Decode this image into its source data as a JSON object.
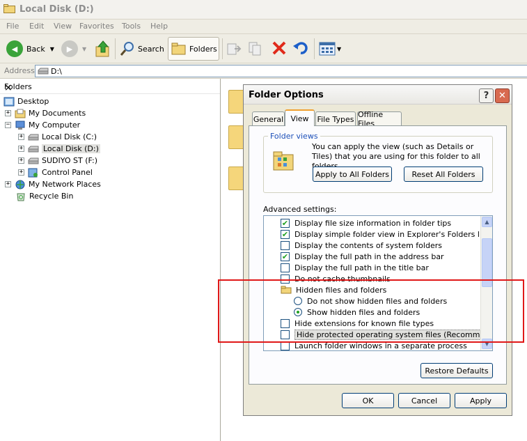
{
  "window": {
    "title": "Local Disk (D:)"
  },
  "menu": [
    "File",
    "Edit",
    "View",
    "Favorites",
    "Tools",
    "Help"
  ],
  "toolbar": {
    "back": "Back",
    "search": "Search",
    "folders": "Folders"
  },
  "address": {
    "label": "Address",
    "value": "D:\\"
  },
  "folders_pane": {
    "title": "Folders",
    "close": "×",
    "tree": [
      {
        "label": "Desktop",
        "expander": "",
        "selected": false
      },
      {
        "label": "My Documents",
        "expander": "+",
        "selected": false
      },
      {
        "label": "My Computer",
        "expander": "−",
        "selected": false
      },
      {
        "label": "Local Disk (C:)",
        "expander": "+",
        "selected": false
      },
      {
        "label": "Local Disk (D:)",
        "expander": "+",
        "selected": true
      },
      {
        "label": "SUDIYO ST (F:)",
        "expander": "+",
        "selected": false
      },
      {
        "label": "Control Panel",
        "expander": "+",
        "selected": false
      },
      {
        "label": "My Network Places",
        "expander": "+",
        "selected": false
      },
      {
        "label": "Recycle Bin",
        "expander": "",
        "selected": false
      }
    ]
  },
  "dialog": {
    "title": "Folder Options",
    "help": "?",
    "close": "✕",
    "tabs": [
      "General",
      "View",
      "File Types",
      "Offline Files"
    ],
    "active_tab": "View",
    "folder_views": {
      "legend": "Folder views",
      "text": "You can apply the view (such as Details or Tiles) that you are using for this folder to all folders.",
      "apply_all": "Apply to All Folders",
      "reset_all": "Reset All Folders"
    },
    "advanced_label": "Advanced settings:",
    "advanced": [
      {
        "kind": "checkbox",
        "label": "Display file size information in folder tips",
        "checked": true
      },
      {
        "kind": "checkbox",
        "label": "Display simple folder view in Explorer's Folders list",
        "checked": true
      },
      {
        "kind": "checkbox",
        "label": "Display the contents of system folders",
        "checked": false
      },
      {
        "kind": "checkbox",
        "label": "Display the full path in the address bar",
        "checked": true
      },
      {
        "kind": "checkbox",
        "label": "Display the full path in the title bar",
        "checked": false
      },
      {
        "kind": "checkbox",
        "label": "Do not cache thumbnails",
        "checked": false
      },
      {
        "kind": "folder",
        "label": "Hidden files and folders"
      },
      {
        "kind": "radio",
        "label": "Do not show hidden files and folders",
        "checked": false
      },
      {
        "kind": "radio",
        "label": "Show hidden files and folders",
        "checked": true
      },
      {
        "kind": "checkbox",
        "label": "Hide extensions for known file types",
        "checked": false
      },
      {
        "kind": "checkbox",
        "label": "Hide protected operating system files (Recommended)",
        "checked": false,
        "focused": true
      },
      {
        "kind": "checkbox",
        "label": "Launch folder windows in a separate process",
        "checked": false
      }
    ],
    "restore_defaults": "Restore Defaults",
    "ok": "OK",
    "cancel": "Cancel",
    "apply": "Apply"
  },
  "colors": {
    "highlight_box": "#e01818",
    "check": "#21a121",
    "xp_blue": "#003c74"
  }
}
